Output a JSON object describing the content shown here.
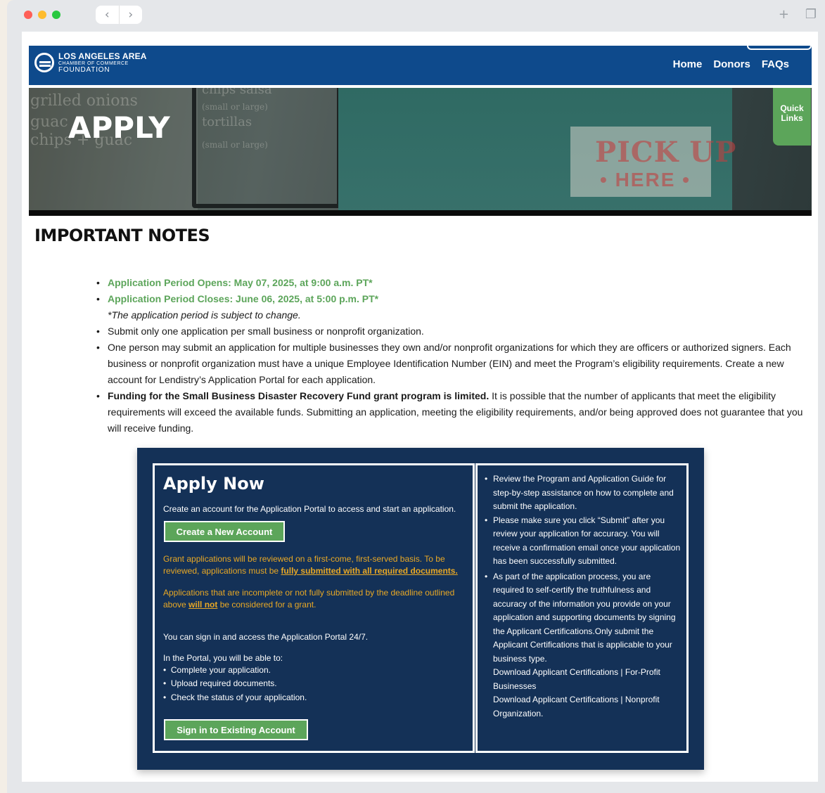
{
  "window": {
    "nav_back": "‹",
    "nav_forward": "›",
    "new_tab_icon": "+",
    "tabs_icon": "❐"
  },
  "header": {
    "logo_line1": "LOS ANGELES AREA",
    "logo_line2": "CHAMBER OF COMMERCE",
    "logo_line3": "FOUNDATION",
    "nav": [
      "Home",
      "Donors",
      "FAQs"
    ]
  },
  "hero": {
    "title": "APPLY",
    "menu1": "grilled onions",
    "menu2": "guac",
    "menu3": "chips + guac",
    "menu4": "chips   salsa",
    "menu5": "(small or large)",
    "menu6": "tortillas",
    "menu7": "(small or large)",
    "sign1": "PICK UP",
    "sign2": "• HERE •"
  },
  "quick_links": "Quick Links",
  "notes": {
    "title": "IMPORTANT NOTES",
    "opens": "Application Period Opens: May 07, 2025, at 9:00 a.m. PT*",
    "closes": "Application Period Closes: June 06, 2025, at 5:00 p.m. PT*",
    "subject": "*The application period is subject to change.",
    "one_app": "Submit only one application per small business or nonprofit organization.",
    "multi": "One person may submit an application for multiple businesses they own and/or nonprofit organizations for which they are officers or authorized signers. Each business or nonprofit organization must have a unique Employee Identification Number (EIN) and meet the Program’s eligibility requirements. Create a new account for Lendistry’s Application Portal for each application.",
    "funding_bold": "Funding for the Small Business Disaster Recovery Fund grant program is limited.",
    "funding_rest": " It is possible that the number of applicants that meet the eligibility requirements will exceed the available funds. Submitting an application, meeting the eligibility requirements, and/or being approved does not guarantee that you will receive funding."
  },
  "panel": {
    "title": "Apply Now",
    "create_text": "Create an account for the Application Portal to access and start an application.",
    "create_btn": "Create a New Account",
    "review_text": "Grant applications will be reviewed on a first-come, first-served basis. To be reviewed, applications must be ",
    "review_bold": "fully submitted with all required documents.",
    "incomplete_text": "Applications that are incomplete or not fully submitted by the deadline outlined above ",
    "will_not": "will not",
    "incomplete_rest": " be considered for a grant.",
    "signin_text": "You can sign in and access the Application Portal 24/7.",
    "portal_intro": "In the Portal, you will be able to:",
    "portal_items": [
      "Complete your application.",
      "Upload required documents.",
      "Check the status of your application."
    ],
    "signin_btn": "Sign in to Existing Account",
    "right_items": [
      "Review the Program and Application Guide for step-by-step assistance on how to complete and submit the application.",
      "Please make sure you click “Submit” after you review your application for accuracy. You will receive a confirmation email once your application has been successfully submitted.",
      "As part of the application process, you are required to self-certify the truthfulness and accuracy of the information you provide on your application and supporting documents by signing the Applicant Certifications.Only submit the Applicant Certifications that is applicable to your business type."
    ],
    "download_forprofit": "Download Applicant Certifications | For-Profit Businesses",
    "download_nonprofit": "Download Applicant Certifications | Nonprofit Organization."
  }
}
